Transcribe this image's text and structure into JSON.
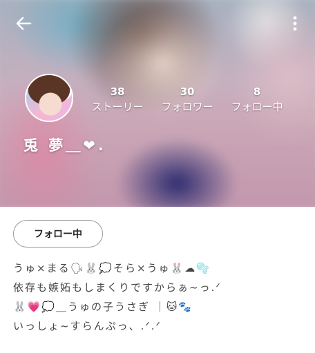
{
  "header": {
    "back_icon": "arrow-left-icon",
    "more_icon": "more-vert-icon"
  },
  "profile": {
    "display_name": "兎 夢＿❤︎.",
    "stats": {
      "stories": {
        "count": "38",
        "label": "ストーリー"
      },
      "followers": {
        "count": "30",
        "label": "フォロワー"
      },
      "following": {
        "count": "8",
        "label": "フォロー中"
      }
    }
  },
  "actions": {
    "follow_button_label": "フォロー中"
  },
  "bio": {
    "lines": [
      "うゅ×まる🗣🐰💭そら×うゅ🐰☁🫧",
      "依存も嫉妬もしまくりですからぁ~っ.ᐟ",
      "🐰💗💭＿うゅの子うさぎ ｜🐱🐾",
      "いっしょ~すらんぷっ、.ᐟ.ᐟ"
    ]
  },
  "colors": {
    "text_on_image": "#ffffff",
    "body_text": "#444444",
    "button_border": "#9a9a9a"
  }
}
